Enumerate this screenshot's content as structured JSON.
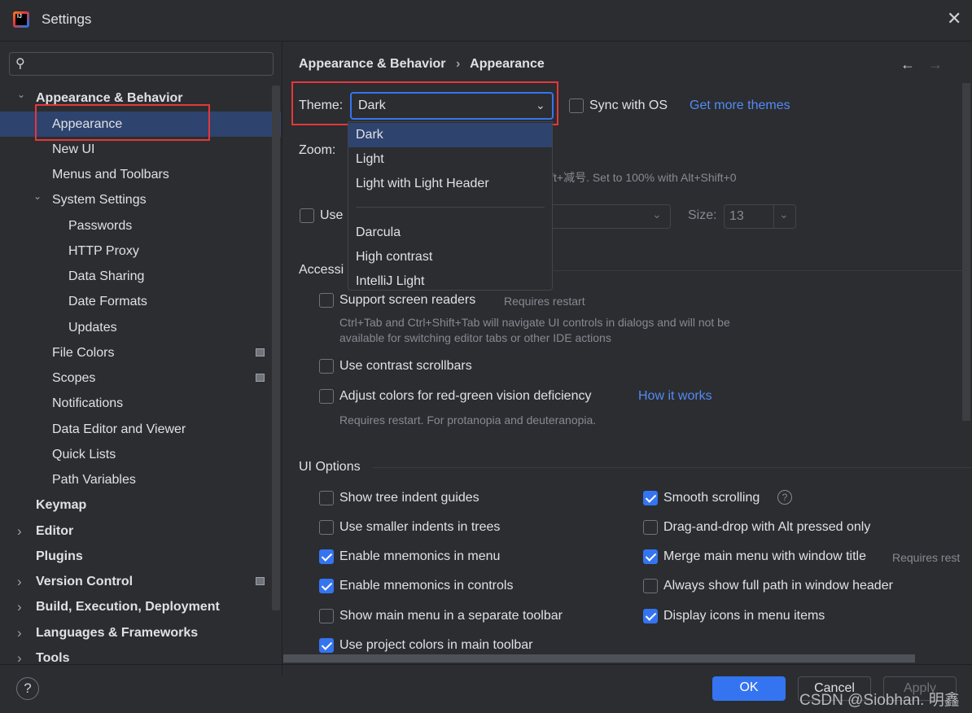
{
  "window": {
    "title": "Settings",
    "close_icon": "close-icon",
    "app_icon": "intellij-idea-icon"
  },
  "sidebar": {
    "search_placeholder": "",
    "items": [
      {
        "label": "Appearance & Behavior",
        "level": 0,
        "expanded": true,
        "bold": true
      },
      {
        "label": "Appearance",
        "level": 1,
        "selected": true
      },
      {
        "label": "New UI",
        "level": 1
      },
      {
        "label": "Menus and Toolbars",
        "level": 1
      },
      {
        "label": "System Settings",
        "level": 1,
        "expanded": true
      },
      {
        "label": "Passwords",
        "level": 2
      },
      {
        "label": "HTTP Proxy",
        "level": 2
      },
      {
        "label": "Data Sharing",
        "level": 2
      },
      {
        "label": "Date Formats",
        "level": 2
      },
      {
        "label": "Updates",
        "level": 2
      },
      {
        "label": "File Colors",
        "level": 1,
        "badge": true
      },
      {
        "label": "Scopes",
        "level": 1,
        "badge": true
      },
      {
        "label": "Notifications",
        "level": 1
      },
      {
        "label": "Data Editor and Viewer",
        "level": 1
      },
      {
        "label": "Quick Lists",
        "level": 1
      },
      {
        "label": "Path Variables",
        "level": 1
      },
      {
        "label": "Keymap",
        "level": 0
      },
      {
        "label": "Editor",
        "level": 0,
        "collapsed": true
      },
      {
        "label": "Plugins",
        "level": 0
      },
      {
        "label": "Version Control",
        "level": 0,
        "collapsed": true,
        "badge": true
      },
      {
        "label": "Build, Execution, Deployment",
        "level": 0,
        "collapsed": true
      },
      {
        "label": "Languages & Frameworks",
        "level": 0,
        "collapsed": true
      },
      {
        "label": "Tools",
        "level": 0,
        "collapsed": true
      }
    ]
  },
  "breadcrumb": {
    "parent": "Appearance & Behavior",
    "sep": "›",
    "current": "Appearance",
    "back": "←",
    "forward": "→"
  },
  "theme": {
    "label": "Theme:",
    "value": "Dark",
    "sync_label": "Sync with OS",
    "sync_checked": false,
    "more_link": "Get more themes",
    "options": [
      "Dark",
      "Light",
      "Light with Light Header",
      "Darcula",
      "High contrast",
      "IntelliJ Light"
    ]
  },
  "zoom": {
    "label": "Zoom:",
    "hint_visible": "ift+减号. Set to 100% with Alt+Shift+0"
  },
  "font": {
    "use_label": "Use",
    "size_label": "Size:",
    "size_value": "13"
  },
  "accessibility": {
    "title": "Accessi",
    "screen_readers": {
      "label": "Support screen readers",
      "note": "Requires restart",
      "desc1": "Ctrl+Tab and Ctrl+Shift+Tab will navigate UI controls in dialogs and will not be",
      "desc2": "available for switching editor tabs or other IDE actions",
      "checked": false
    },
    "contrast_scrollbars": {
      "label": "Use contrast scrollbars",
      "checked": false
    },
    "red_green": {
      "label": "Adjust colors for red-green vision deficiency",
      "link": "How it works",
      "desc": "Requires restart. For protanopia and deuteranopia.",
      "checked": false
    }
  },
  "ui_options": {
    "title": "UI Options",
    "left": [
      {
        "label": "Show tree indent guides",
        "checked": false
      },
      {
        "label": "Use smaller indents in trees",
        "checked": false
      },
      {
        "label": "Enable mnemonics in menu",
        "checked": true
      },
      {
        "label": "Enable mnemonics in controls",
        "checked": true
      },
      {
        "label": "Show main menu in a separate toolbar",
        "checked": false
      },
      {
        "label": "Use project colors in main toolbar",
        "checked": true
      }
    ],
    "right": [
      {
        "label": "Smooth scrolling",
        "checked": true,
        "help": "?"
      },
      {
        "label": "Drag-and-drop with Alt pressed only",
        "checked": false
      },
      {
        "label": "Merge main menu with window title",
        "checked": true,
        "note": "Requires rest"
      },
      {
        "label": "Always show full path in window header",
        "checked": false
      },
      {
        "label": "Display icons in menu items",
        "checked": true
      }
    ]
  },
  "footer": {
    "help": "?",
    "ok": "OK",
    "cancel": "Cancel",
    "apply": "Apply",
    "watermark": "CSDN @Siobhan. 明鑫"
  },
  "colors": {
    "background": "#2b2d30",
    "selection": "#2e436e",
    "accent": "#3574f0",
    "link": "#548af7",
    "highlight_box": "#e5373b"
  }
}
